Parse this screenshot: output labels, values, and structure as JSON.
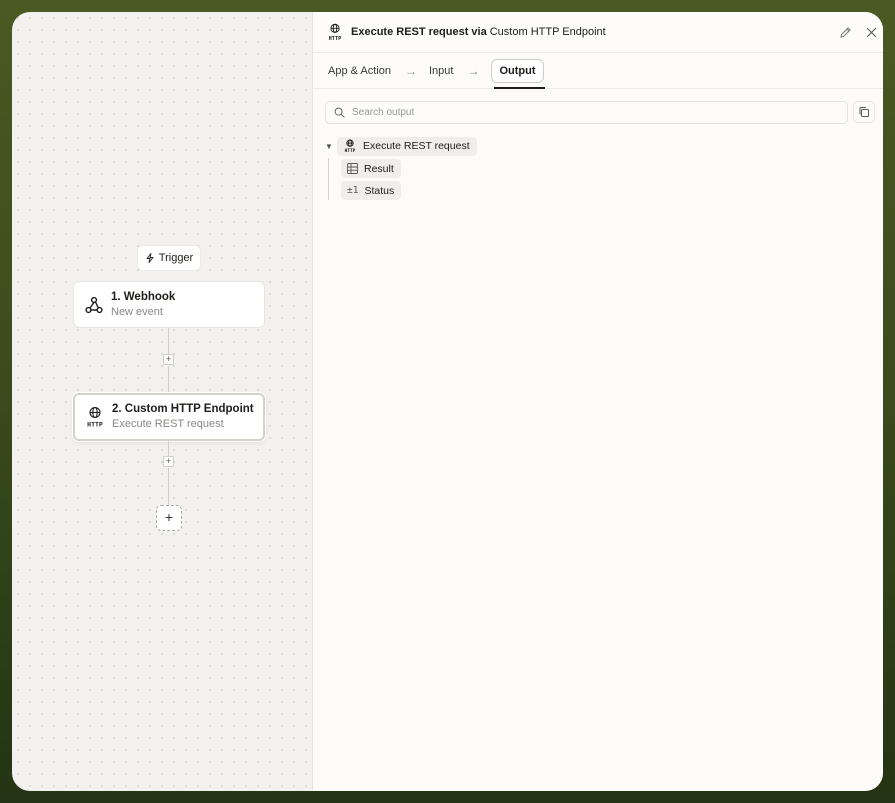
{
  "canvas": {
    "trigger_label": "Trigger",
    "steps": [
      {
        "title": "1. Webhook",
        "subtitle": "New event"
      },
      {
        "title": "2. Custom HTTP Endpoint",
        "subtitle": "Execute REST request"
      }
    ]
  },
  "panel": {
    "title": "Execute REST request via",
    "title_app": "Custom HTTP Endpoint",
    "tabs": [
      {
        "label": "App & Action"
      },
      {
        "label": "Input"
      },
      {
        "label": "Output"
      }
    ],
    "search_placeholder": "Search output",
    "tree": {
      "root_label": "Execute REST request",
      "children": [
        {
          "label": "Result",
          "icon": "table-icon"
        },
        {
          "label": "Status",
          "icon": "plus-minus-icon",
          "icon_text": "±1"
        }
      ]
    }
  },
  "colors": {
    "accent": "#1f1d1a",
    "frame_bg": "#4a5a23"
  }
}
